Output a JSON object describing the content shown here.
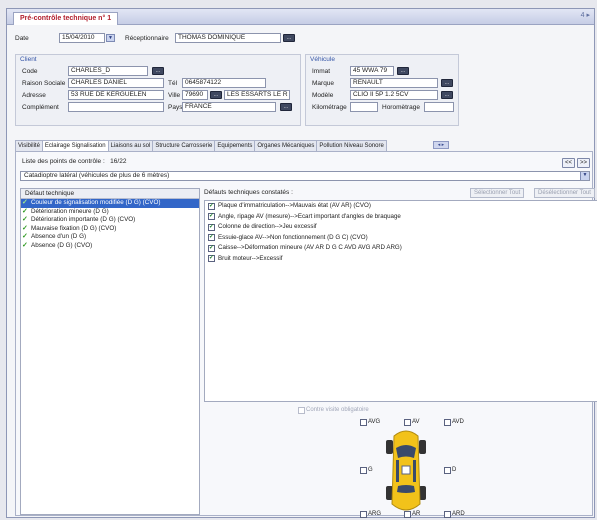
{
  "window": {
    "title": "Pré-contrôle technique n° 1",
    "controls": "4 ▸"
  },
  "header": {
    "date_label": "Date",
    "date_value": "15/04/2010",
    "receptionnaire_label": "Réceptionnaire",
    "receptionnaire_value": "THOMAS DOMINIQUE"
  },
  "client": {
    "title": "Client",
    "code_label": "Code",
    "code_value": "CHARLES_D",
    "raison_label": "Raison Sociale",
    "raison_value": "CHARLES DANIEL",
    "tel_label": "Tél",
    "tel_value": "0645874122",
    "adresse_label": "Adresse",
    "adresse_value": "53 RUE DE KERGUELEN",
    "ville_label": "Ville",
    "cp_value": "79690",
    "ville_value": "LES ESSARTS LE R",
    "complement_label": "Complément",
    "complement_value": "",
    "pays_label": "Pays",
    "pays_value": "FRANCE"
  },
  "vehicule": {
    "title": "Véhicule",
    "immat_label": "Immat",
    "immat_value": "45 WWA 79",
    "marque_label": "Marque",
    "marque_value": "RENAULT",
    "modele_label": "Modèle",
    "modele_value": "CLIO II 5P 1.2 5CV",
    "km_label": "Kilométrage",
    "km_value": "",
    "horo_label": "Horomètrage",
    "horo_value": ""
  },
  "lookup_label": "...",
  "tabs": [
    {
      "label": "Visibilité"
    },
    {
      "label": "Eclairage Signalisation"
    },
    {
      "label": "Liaisons au sol"
    },
    {
      "label": "Structure Carrosserie"
    },
    {
      "label": "Equipements"
    },
    {
      "label": "Organes Mécaniques"
    },
    {
      "label": "Pollution Niveau Sonore"
    }
  ],
  "tab_scroll": "◂ ▸",
  "points": {
    "label": "Liste des points de contrôle :",
    "count": "16/22",
    "prev": "<<",
    "next": ">>"
  },
  "point_selected": "Catadioptre latéral (véhicules de plus de 6 mètres)",
  "defauts": {
    "header": "Défaut technique",
    "items": [
      "Couleur de signalisation modifiée (D G) (CVO)",
      "Détérioration mineure (D G)",
      "Détérioration importante (D G) (CVO)",
      "Mauvaise fixation (D G) (CVO)",
      "Absence d'un (D G)",
      "Absence (D G) (CVO)"
    ]
  },
  "constates": {
    "header": "Défauts techniques constatés :",
    "select_all": "Sélectionner Tout",
    "deselect_all": "Désélectionner Tout",
    "check_mark": "✓",
    "items": [
      "Plaque d'immatriculation-->Mauvais état (AV AR) (CVO)",
      "Angle, ripage AV (mesure)-->Ecart important d'angles de braquage",
      "Colonne de direction-->Jeu excessif",
      "Essuie-glace AV-->Non fonctionnement (D G C) (CVO)",
      "Caisse-->Déformation mineure (AV AR D G C AVD AVG ARD ARG)",
      "Bruit moteur-->Excessif"
    ]
  },
  "contre_visite": "Contre visite obligatoire",
  "positions": {
    "avg": "AVG",
    "av": "AV",
    "avd": "AVD",
    "g": "G",
    "d": "D",
    "arg": "ARG",
    "ar": "AR",
    "ard": "ARD"
  },
  "colors": {
    "accent": "#3266c8",
    "title_red": "#b2202e",
    "car_body": "#f2c21a"
  }
}
